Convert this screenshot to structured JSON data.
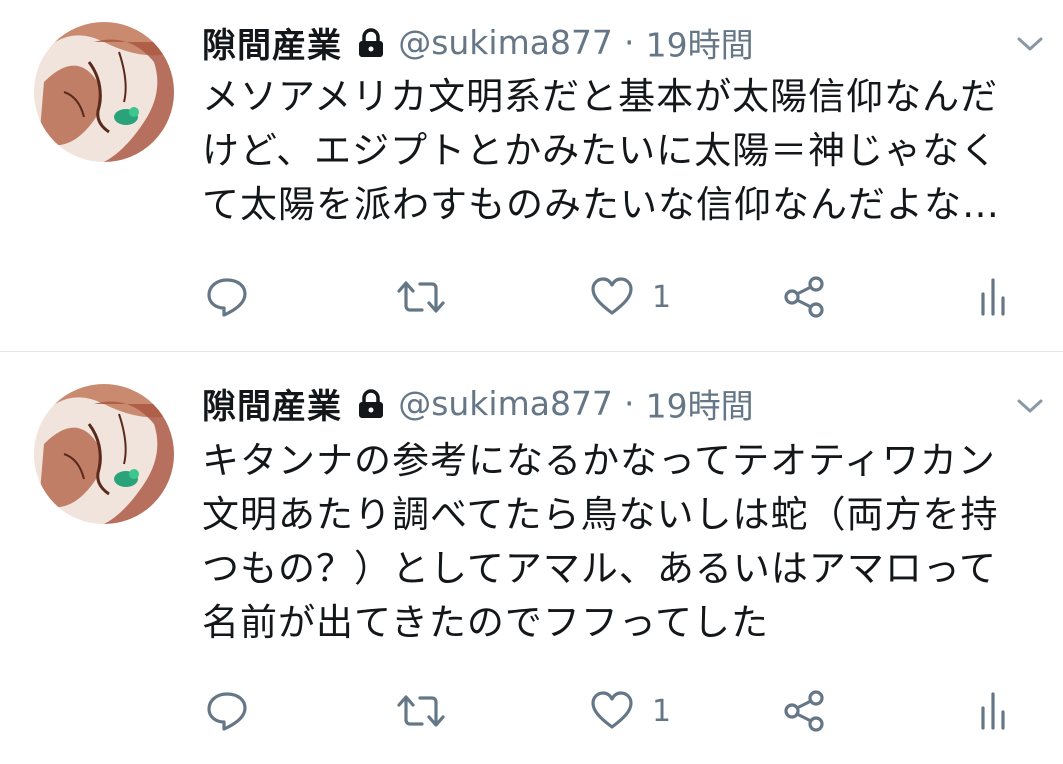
{
  "colors": {
    "text": "#14171a",
    "muted": "#657786",
    "divider": "#e1e8ed"
  },
  "tweets": [
    {
      "author_name": "隙間産業",
      "protected_icon": "lock-icon",
      "handle": "@sukima877",
      "separator": "·",
      "time": "19時間",
      "text": "メソアメリカ文明系だと基本が太陽信仰なんだ\nけど、エジプトとかみたいに太陽＝神じゃなく\nて太陽を派わすものみたいな信仰なんだよな…",
      "like_count": "1"
    },
    {
      "author_name": "隙間産業",
      "protected_icon": "lock-icon",
      "handle": "@sukima877",
      "separator": "·",
      "time": "19時間",
      "text": "キタンナの参考になるかなってテオティワカン\n文明あたり調べてたら鳥ないしは蛇（両方を持\nつもの？）としてアマル、あるいはアマロって\n名前が出てきたのでフフってした",
      "like_count": "1"
    }
  ],
  "action_icons": [
    "reply-icon",
    "retweet-icon",
    "like-icon",
    "share-icon",
    "analytics-icon"
  ]
}
